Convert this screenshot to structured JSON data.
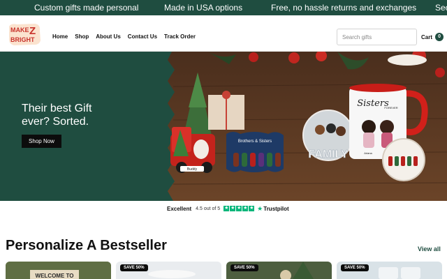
{
  "announcement": {
    "messages": [
      "Custom gifts made personal",
      "Made in USA options",
      "Free, no hassle returns and exchanges",
      "Sec"
    ]
  },
  "header": {
    "logo_text_top": "MAKE",
    "logo_letter": "Z",
    "logo_text_bottom": "BRIGHT",
    "nav": [
      "Home",
      "Shop",
      "About Us",
      "Contact Us",
      "Track Order"
    ],
    "search_placeholder": "Search gifts",
    "cart_label": "Cart",
    "cart_count": "0"
  },
  "hero": {
    "title_line1": "Their best Gift",
    "title_line2": "ever? Sorted.",
    "cta_label": "Shop Now",
    "image_text": {
      "mug": "Sisters",
      "mug_sub": "FOREVER",
      "mug_names": [
        "Ariana",
        "Tamsy"
      ],
      "ornament": "Brothers & Sisters",
      "truck_name": "Buddy",
      "family": "FAMILY"
    }
  },
  "trust": {
    "label": "Excellent",
    "rating": "4.5 out of 5",
    "stars": 4.5,
    "brand": "Trustpilot"
  },
  "bestseller": {
    "title": "Personalize A Bestseller",
    "view_all": "View all",
    "cards": [
      {
        "badge": "",
        "image_text": "WELCOME TO"
      },
      {
        "badge": "SAVE 50%"
      },
      {
        "badge": "SAVE 50%"
      },
      {
        "badge": "SAVE 50%"
      }
    ]
  },
  "colors": {
    "brand_green": "#1f4d40",
    "trust_green": "#00b67a",
    "button_black": "#0c0c0c"
  }
}
